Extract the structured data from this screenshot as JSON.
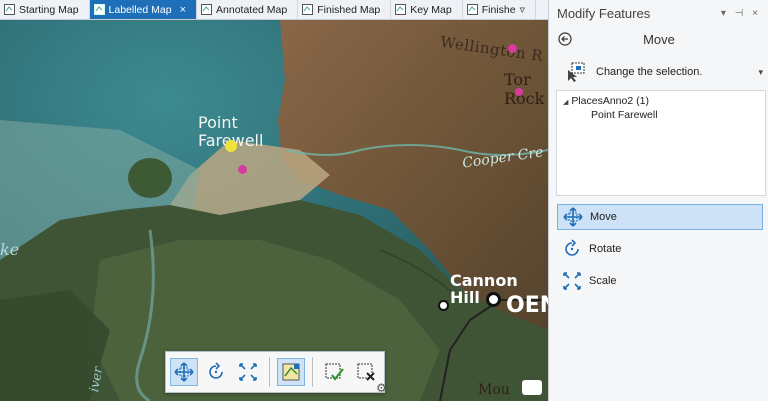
{
  "tabs": [
    {
      "label": "Starting Map"
    },
    {
      "label": "Labelled Map",
      "close": "×"
    },
    {
      "label": "Annotated Map"
    },
    {
      "label": "Finished Map"
    },
    {
      "label": "Key Map"
    },
    {
      "label": "Finishe",
      "overflow": "▿"
    }
  ],
  "map_labels": {
    "point_farewell": "Point\nFarewell",
    "wellington": "Wellington R",
    "tor_rock": "Tor\nRock",
    "cooper_creek": "Cooper Cre",
    "cannon_hill": "Cannon\nHill",
    "oen": "OEN",
    "ke": "ke",
    "river": "iver",
    "mount": "Mou"
  },
  "pane": {
    "title": "Modify Features",
    "header_buttons": "▾ ⊣ ×",
    "tool_title": "Move",
    "selection_label": "Change the selection.",
    "selection_caret": "▾",
    "tree": {
      "layer": "PlacesAnno2 (1)",
      "expander": "◢",
      "feature": "Point Farewell"
    },
    "tools": [
      {
        "label": "Move",
        "icon": "move-icon",
        "selected": true
      },
      {
        "label": "Rotate",
        "icon": "rotate-icon",
        "selected": false
      },
      {
        "label": "Scale",
        "icon": "scale-icon",
        "selected": false
      }
    ]
  },
  "colors": {
    "accent": "#1e6fb8",
    "selection": "#cde2f7",
    "magenta_marker": "#d63ca0",
    "yellow_marker": "#f0e23a"
  }
}
